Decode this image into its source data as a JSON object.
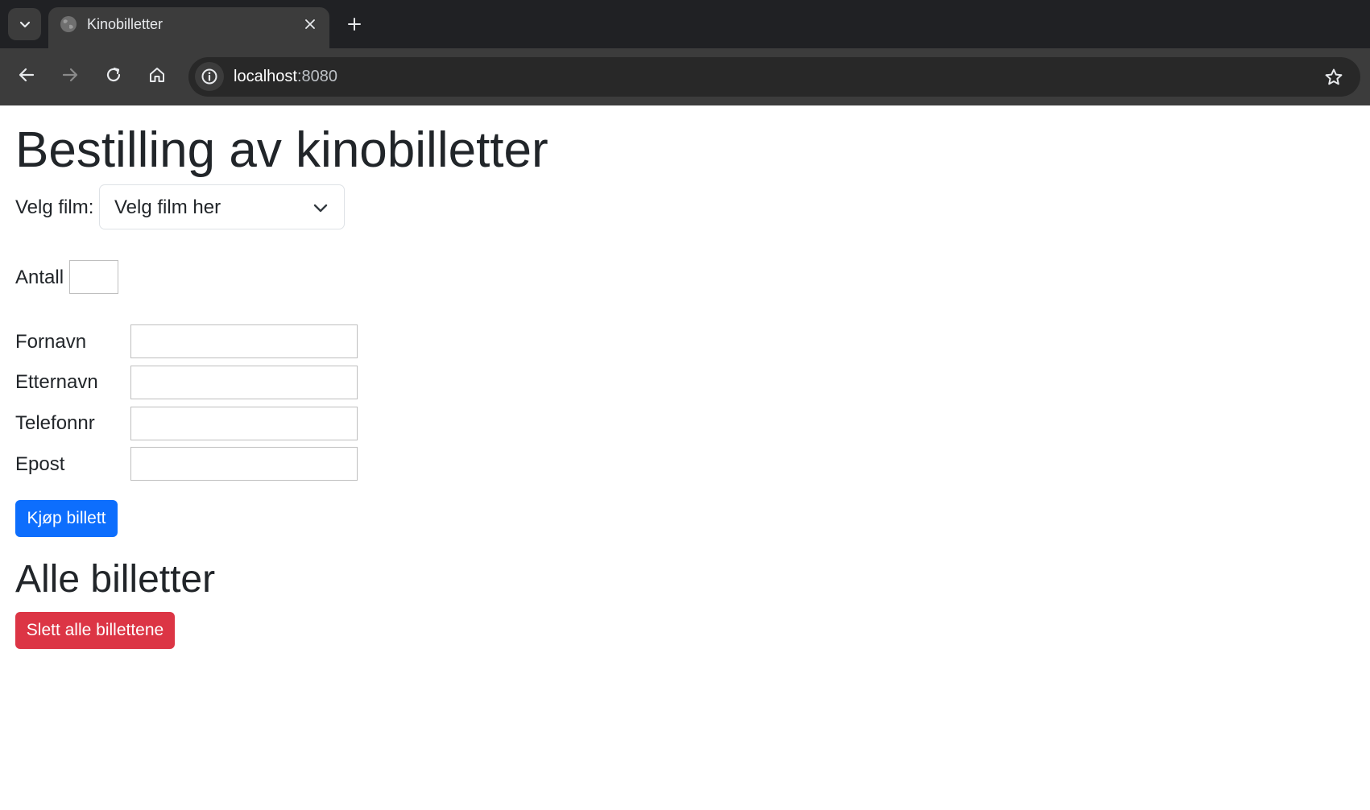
{
  "browser": {
    "tab": {
      "title": "Kinobilletter"
    },
    "address_bar": {
      "host": "localhost",
      "port": ":8080"
    }
  },
  "page": {
    "title": "Bestilling av kinobilletter",
    "film_select": {
      "label": "Velg film:",
      "selected": "Velg film her"
    },
    "quantity": {
      "label": "Antall",
      "value": ""
    },
    "fields": {
      "first_name": {
        "label": "Fornavn",
        "value": ""
      },
      "last_name": {
        "label": "Etternavn",
        "value": ""
      },
      "phone": {
        "label": "Telefonnr",
        "value": ""
      },
      "email": {
        "label": "Epost",
        "value": ""
      }
    },
    "buy_button": {
      "label": "Kjøp billett",
      "color": "#0d6efd"
    },
    "tickets_section": {
      "title": "Alle billetter"
    },
    "delete_all_button": {
      "label": "Slett alle billettene",
      "color": "#dc3545"
    }
  }
}
